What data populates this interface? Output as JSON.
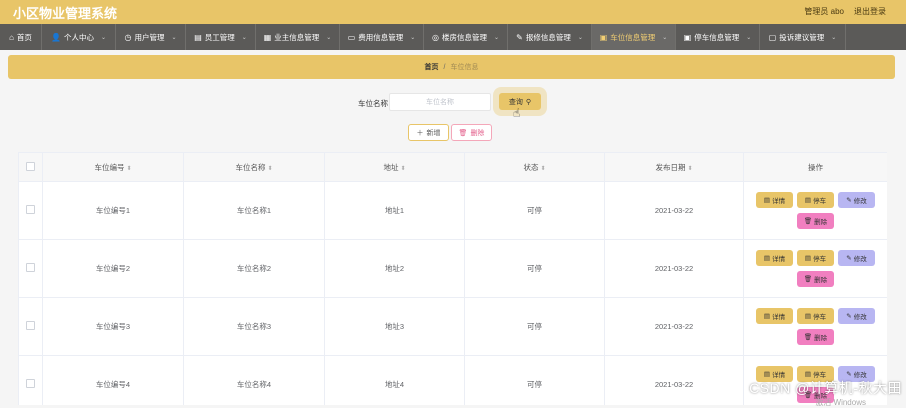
{
  "header": {
    "app_title": "小区物业管理系统",
    "user_label": "管理员 abo",
    "logout_label": "退出登录"
  },
  "nav": {
    "items": [
      {
        "label": "首页",
        "icon": "home-icon",
        "has_caret": false
      },
      {
        "label": "个人中心",
        "icon": "user-icon",
        "has_caret": true
      },
      {
        "label": "用户管理",
        "icon": "clock-icon",
        "has_caret": true
      },
      {
        "label": "员工管理",
        "icon": "document-icon",
        "has_caret": true
      },
      {
        "label": "业主信息管理",
        "icon": "building-icon",
        "has_caret": true
      },
      {
        "label": "费用信息管理",
        "icon": "wallet-icon",
        "has_caret": true
      },
      {
        "label": "楼房信息管理",
        "icon": "location-icon",
        "has_caret": true
      },
      {
        "label": "报修信息管理",
        "icon": "wrench-icon",
        "has_caret": true
      },
      {
        "label": "车位信息管理",
        "icon": "parking-icon",
        "has_caret": true,
        "active": true
      },
      {
        "label": "停车信息管理",
        "icon": "car-icon",
        "has_caret": true
      },
      {
        "label": "投诉建议管理",
        "icon": "chat-icon",
        "has_caret": true
      }
    ]
  },
  "breadcrumb": {
    "home": "首页",
    "separator": "/",
    "current": "车位信息"
  },
  "search": {
    "label": "车位名称",
    "placeholder": "车位名称",
    "value": "",
    "query_label": "查询"
  },
  "actions": {
    "add_label": "新增",
    "delete_label": "删除"
  },
  "table": {
    "columns": [
      "车位编号",
      "车位名称",
      "地址",
      "状态",
      "发布日期",
      "操作"
    ],
    "rows": [
      {
        "code": "车位编号1",
        "name": "车位名称1",
        "address": "地址1",
        "status": "可停",
        "date": "2021-03-22"
      },
      {
        "code": "车位编号2",
        "name": "车位名称2",
        "address": "地址2",
        "status": "可停",
        "date": "2021-03-22"
      },
      {
        "code": "车位编号3",
        "name": "车位名称3",
        "address": "地址3",
        "status": "可停",
        "date": "2021-03-22"
      },
      {
        "code": "车位编号4",
        "name": "车位名称4",
        "address": "地址4",
        "status": "可停",
        "date": "2021-03-22"
      }
    ],
    "ops": {
      "detail": "详情",
      "park": "停车",
      "edit": "修改",
      "delete": "删除"
    }
  },
  "overlay": {
    "watermark": "CSDN @计算机-秋大田",
    "windows_text": "激活 Windows"
  },
  "colors": {
    "accent": "#e8c568",
    "nav_bg": "#5b5a58",
    "edit": "#b8b6f2",
    "delete": "#f17fc0"
  }
}
